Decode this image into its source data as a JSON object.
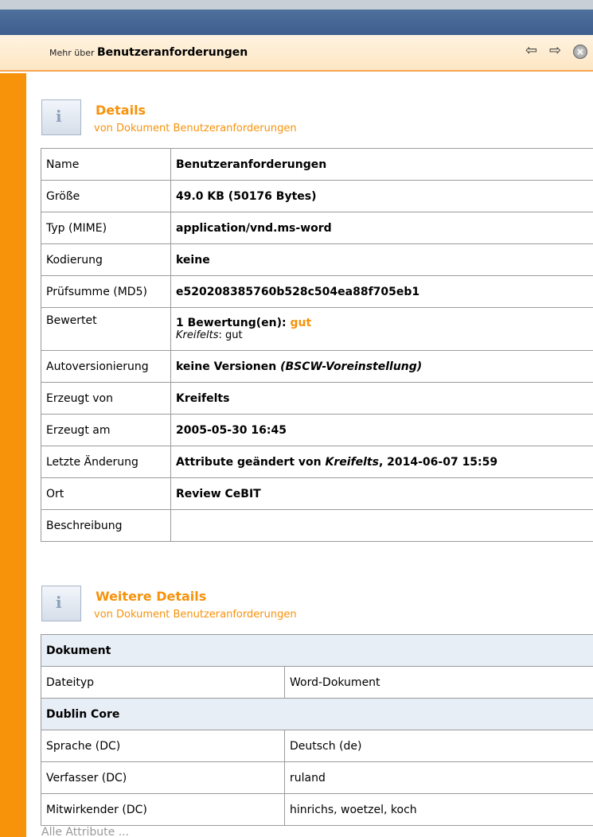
{
  "header": {
    "prefix": "Mehr über",
    "title": "Benutzeranforderungen",
    "icons": [
      "arrow-left-icon",
      "arrow-right-icon",
      "close-icon"
    ]
  },
  "details": {
    "icon": "info-icon",
    "title": "Details",
    "subtitle": "von Dokument Benutzeranforderungen",
    "rows": {
      "name": {
        "label": "Name",
        "value": "Benutzeranforderungen"
      },
      "size": {
        "label": "Größe",
        "value": "49.0 KB (50176 Bytes)"
      },
      "mime": {
        "label": "Typ (MIME)",
        "value": "application/vnd.ms-word"
      },
      "encoding": {
        "label": "Kodierung",
        "value": "keine"
      },
      "checksum": {
        "label": "Prüfsumme (MD5)",
        "value": "e520208385760b528c504ea88f705eb1"
      },
      "rating": {
        "label": "Bewertet",
        "value": "1 Bewertung(en):",
        "rating_word": "gut",
        "rater": "Kreifelts",
        "rater_rating": ": gut"
      },
      "autoversion": {
        "label": "Autoversionierung",
        "value": "keine Versionen",
        "note": "(BSCW-Voreinstellung)"
      },
      "created_by": {
        "label": "Erzeugt von",
        "value": "Kreifelts"
      },
      "created_at": {
        "label": "Erzeugt am",
        "value": "2005-05-30 16:45"
      },
      "last_change": {
        "label": "Letzte Änderung",
        "value": "Attribute geändert von",
        "user": "Kreifelts",
        "date": ", 2014-06-07 15:59"
      },
      "location": {
        "label": "Ort",
        "value": "Review CeBIT"
      },
      "description": {
        "label": "Beschreibung",
        "value": ""
      }
    }
  },
  "more": {
    "icon": "info-icon",
    "title": "Weitere Details",
    "subtitle": "von Dokument Benutzeranforderungen",
    "group_document": "Dokument",
    "filetype": {
      "label": "Dateityp",
      "value": "Word-Dokument"
    },
    "group_dublin": "Dublin Core",
    "language": {
      "label": "Sprache (DC)",
      "value": "Deutsch (de)"
    },
    "author": {
      "label": "Verfasser (DC)",
      "value": "ruland"
    },
    "contributor": {
      "label": "Mitwirkender (DC)",
      "value": "hinrichs, woetzel, koch"
    }
  },
  "all_attributes_link": "Alle Attribute ...",
  "colors": {
    "accent": "#f7920b",
    "group_bg": "#e8eef6",
    "border": "#9a9a9a"
  }
}
